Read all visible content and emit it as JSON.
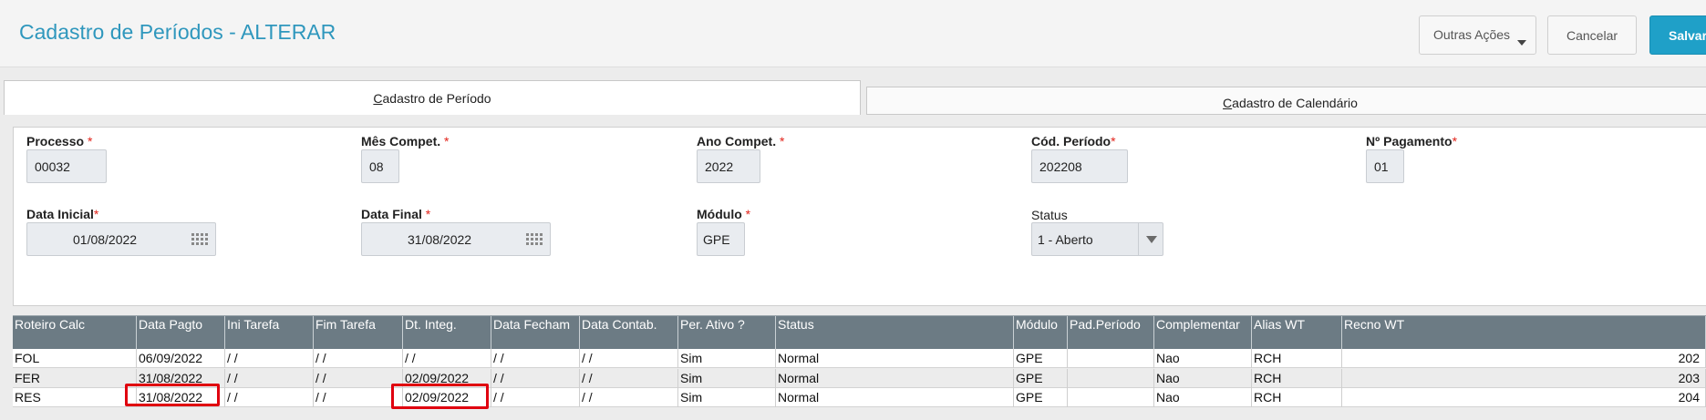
{
  "header": {
    "title": "Cadastro de Períodos - ALTERAR",
    "more_actions": "Outras Ações",
    "cancel": "Cancelar",
    "save": "Salvar"
  },
  "tabs": [
    {
      "label": "Cadastro de Período",
      "underline": "C",
      "rest": "adastro de Período",
      "active": true
    },
    {
      "label": "Cadastro de Calendário",
      "underline": "C",
      "rest": "adastro de Calendário",
      "active": false
    }
  ],
  "form": {
    "processo": {
      "label": "Processo",
      "value": "00032"
    },
    "mes_compet": {
      "label": "Mês Compet.",
      "value": "08"
    },
    "ano_compet": {
      "label": "Ano Compet.",
      "value": "2022"
    },
    "cod_periodo": {
      "label": "Cód. Período",
      "value": "202208"
    },
    "n_pagamento": {
      "label": "Nº Pagamento",
      "value": "01"
    },
    "data_inicial": {
      "label": "Data Inicial",
      "value": "01/08/2022"
    },
    "data_final": {
      "label": "Data Final",
      "value": "31/08/2022"
    },
    "modulo": {
      "label": "Módulo",
      "value": "GPE"
    },
    "status": {
      "label": "Status",
      "value": "1 - Aberto"
    }
  },
  "grid": {
    "columns": [
      "Roteiro Calc",
      "Data Pagto",
      "Ini Tarefa",
      "Fim Tarefa",
      "Dt. Integ.",
      "Data Fecham",
      "Data Contab.",
      "Per. Ativo ?",
      "Status",
      "Módulo",
      "Pad.Período",
      "Complementar",
      "Alias WT",
      "Recno WT"
    ],
    "rows": [
      [
        "FOL",
        "06/09/2022",
        " /  /",
        " /  /",
        " /  /",
        " /  /",
        " /  /",
        "Sim",
        "Normal",
        "GPE",
        "",
        "Nao",
        "RCH",
        "202"
      ],
      [
        "FER",
        "31/08/2022",
        " /  /",
        " /  /",
        "02/09/2022",
        " /  /",
        " /  /",
        "Sim",
        "Normal",
        "GPE",
        "",
        "Nao",
        "RCH",
        "203"
      ],
      [
        "RES",
        "31/08/2022",
        " /  /",
        " /  /",
        "02/09/2022",
        " /  /",
        " /  /",
        "Sim",
        "Normal",
        "GPE",
        "",
        "Nao",
        "RCH",
        "204"
      ]
    ]
  },
  "colors": {
    "accent": "#2f97bd",
    "save_button": "#1fa0c8",
    "grid_header": "#6c7b84",
    "required_mark": "#e2231a",
    "highlight": "#e0000f"
  },
  "icons": [
    "calendar-icon",
    "chevron-down-icon"
  ]
}
